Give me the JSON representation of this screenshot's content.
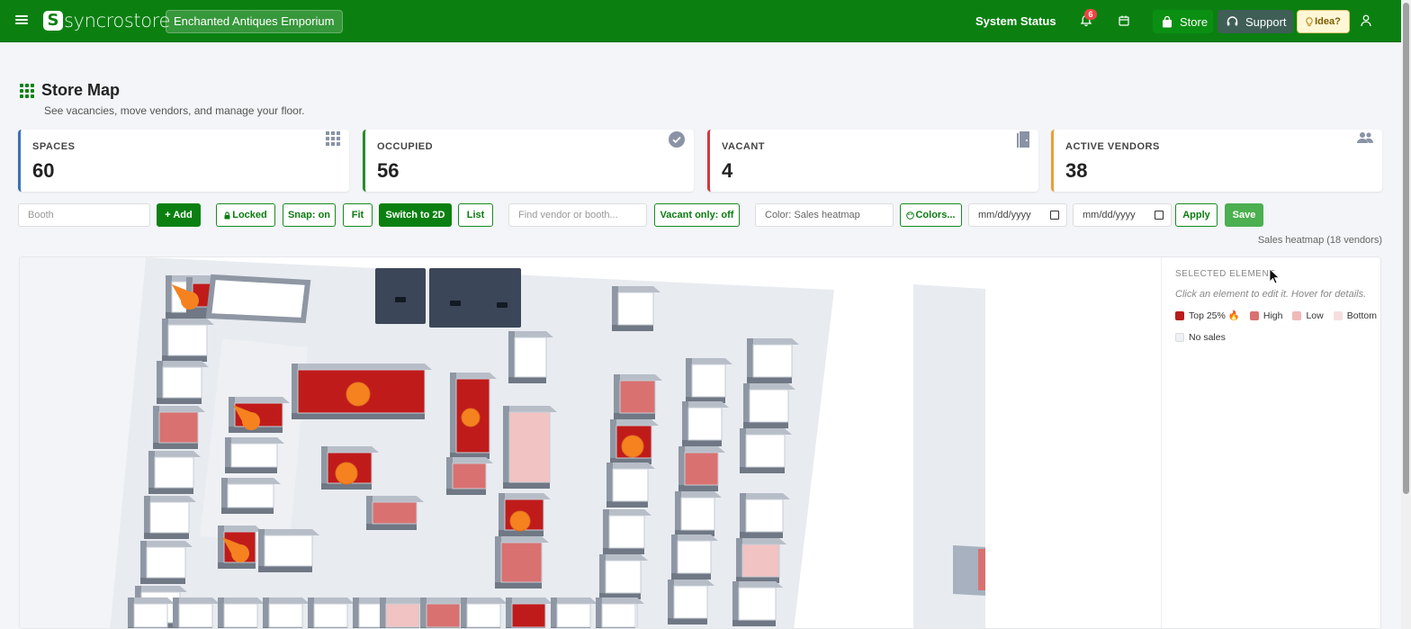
{
  "header": {
    "logo_mark": "S",
    "logo_text": "syncrostore",
    "store_name": "Enchanted Antiques Emporium",
    "system_status": "System Status",
    "notification_count": "6",
    "store_label": "Store",
    "support_label": "Support",
    "idea_label": "Idea?"
  },
  "page": {
    "title": "Store Map",
    "subtitle": "See vacancies, move vendors, and manage your floor."
  },
  "stats": [
    {
      "label": "SPACES",
      "value": "60",
      "accent": "#3b6fb6",
      "icon": "grid-icon"
    },
    {
      "label": "OCCUPIED",
      "value": "56",
      "accent": "#2a8a2f",
      "icon": "check-circle-icon"
    },
    {
      "label": "VACANT",
      "value": "4",
      "accent": "#d9363e",
      "icon": "door-icon"
    },
    {
      "label": "ACTIVE VENDORS",
      "value": "38",
      "accent": "#e6a13a",
      "icon": "users-icon"
    }
  ],
  "toolbar": {
    "booth_placeholder": "Booth",
    "add_label": "+ Add",
    "locked_label": "Locked",
    "snap_label": "Snap: on",
    "fit_label": "Fit",
    "switch_label": "Switch to 2D",
    "list_label": "List",
    "find_placeholder": "Find vendor or booth...",
    "vacant_label": "Vacant only: off",
    "color_mode": "Color: Sales heatmap",
    "colors_label": "Colors...",
    "date_placeholder_1": "mm/dd/yyyy",
    "date_placeholder_2": "mm/dd/yyyy",
    "apply_label": "Apply",
    "save_label": "Save",
    "heatmap_info": "Sales heatmap (18 vendors)"
  },
  "side_panel": {
    "heading": "SELECTED ELEMENT",
    "hint": "Click an element to edit it. Hover for details.",
    "legend": [
      {
        "label": "Top 25% 🔥",
        "color": "#b91c1c"
      },
      {
        "label": "High",
        "color": "#d97171"
      },
      {
        "label": "Low",
        "color": "#efb9b9"
      },
      {
        "label": "Bottom",
        "color": "#f6dede"
      },
      {
        "label": "No sales",
        "color": "#eef0f3"
      }
    ]
  },
  "colors": {
    "brand": "#0b8011",
    "top": "#c01b1b",
    "high": "#d97171",
    "low": "#f1c3c3",
    "wall": "#8e97a3",
    "fixture": "#3b4658",
    "marker": "#f5821f"
  }
}
